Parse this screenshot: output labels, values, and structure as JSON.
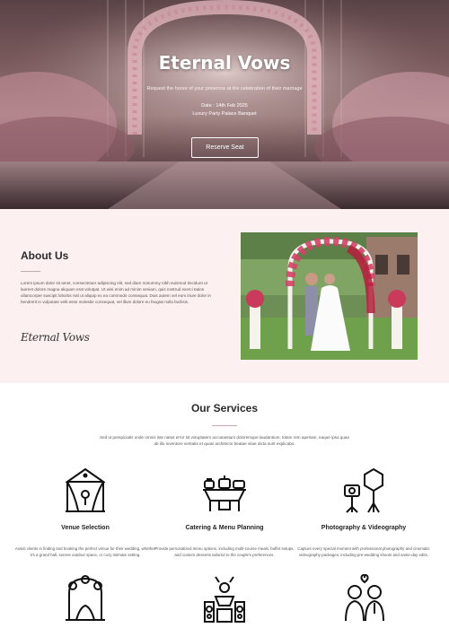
{
  "hero": {
    "title": "Eternal Vows",
    "subtitle": "Request the honor of your presence at the celebration of their marriage",
    "date": "Date : 14th Feb 2025",
    "venue": "Luxury Party Palace Banquet",
    "button_label": "Reserve Seat"
  },
  "about": {
    "title": "About Us",
    "body": "Lorem ipsum dolor sit amet, consectetuer adipiscing elit, sed diam nonummy nibh euismod tincidunt ut laoreet dolore magna aliquam erat volutpat. Ut wisi enim ad minim veniam, quis nostrud exerci tation ullamcorper suscipit lobortis nisl ut aliquip ex ea commodo consequat. Duis autem vel eum iriure dolor in hendrerit in vulputate velit esse molestie consequat, vel illum dolore eu feugiat nulla facilisis.",
    "signature": "Eternal Vows"
  },
  "services": {
    "title": "Our Services",
    "intro": "Sed ut perspiciatis unde omnis iste natus error sit voluptatem accusantium doloremque laudantium, totam rem aperiam, eaque ipsa quae ab illo inventore veritatis et quasi architecto beatae vitae dicta sunt explicabo.",
    "items": [
      {
        "name": "Venue Selection",
        "icon": "venue-arch-icon",
        "desc": "Assist clients in finding and booking the perfect venue for their wedding, whether it's a grand hall, serene outdoor space, or cozy intimate setting."
      },
      {
        "name": "Catering & Menu Planning",
        "icon": "catering-table-icon",
        "desc": "Provide personalized menu options, including multi-course meals, buffet setups, and custom desserts tailored to the couple's preferences."
      },
      {
        "name": "Photography & Videography",
        "icon": "camera-lights-icon",
        "desc": "Capture every special moment with professional photography and cinematic videography packages, including pre-wedding shoots and same-day edits."
      }
    ],
    "more_icons": [
      "floral-arch-icon",
      "dj-music-icon",
      "couple-icon"
    ]
  }
}
